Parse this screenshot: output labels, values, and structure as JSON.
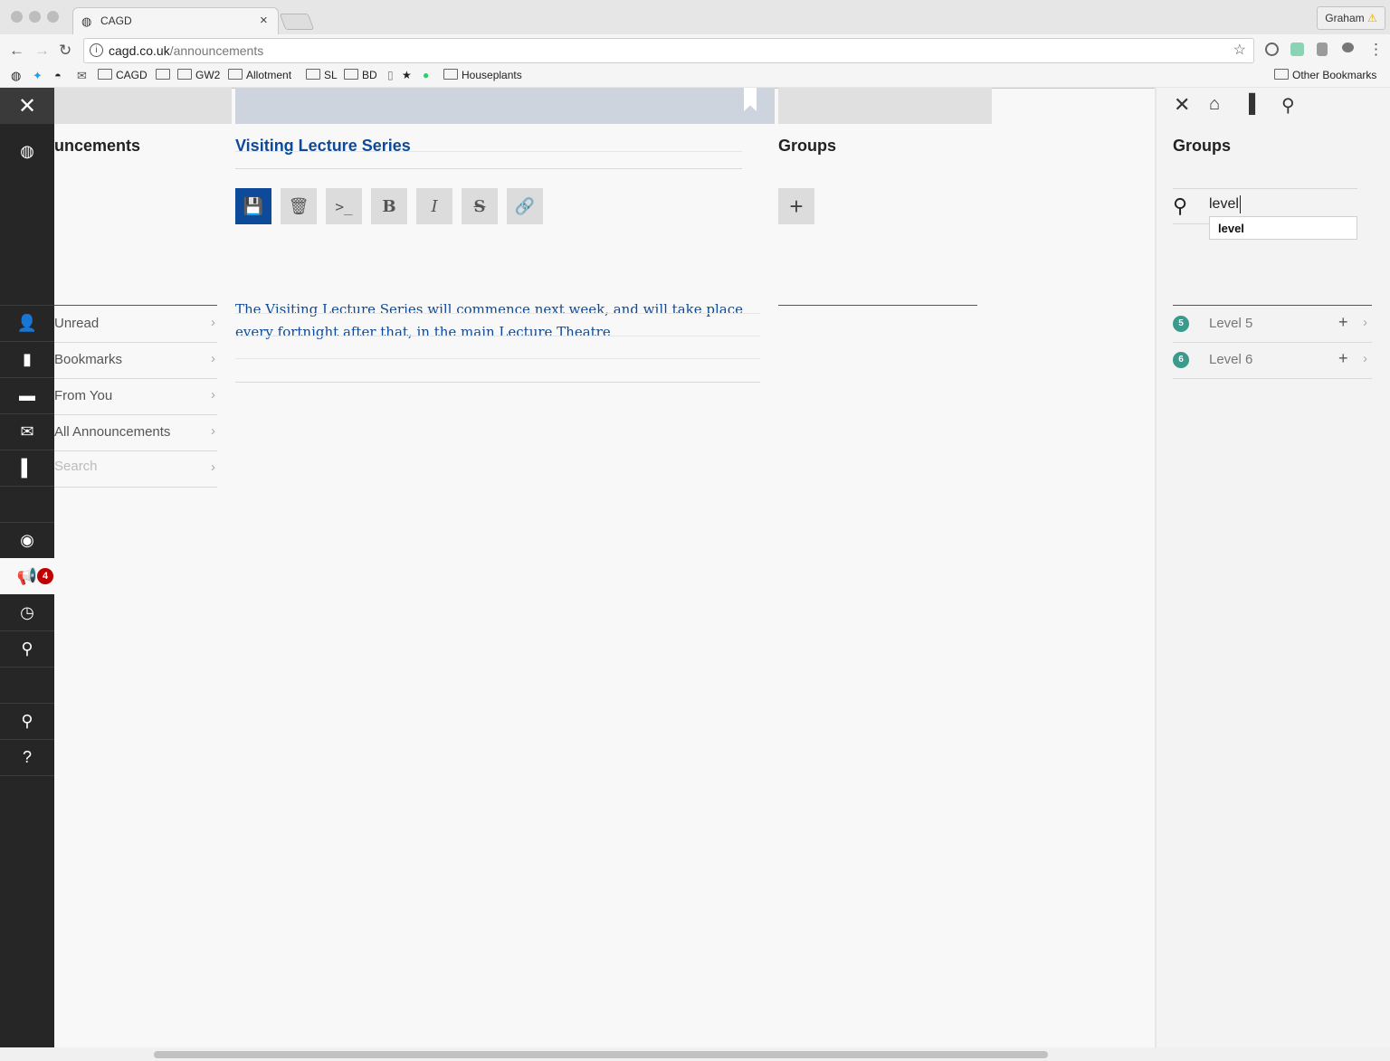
{
  "browser": {
    "tab_title": "CAGD",
    "url_host": "cagd.co.uk",
    "url_path": "/announcements",
    "profile_name": "Graham",
    "bookmarks": [
      "CAGD",
      "GW2",
      "Allotment",
      "SL",
      "BD",
      "★",
      "Houseplants"
    ],
    "other_bookmarks": "Other Bookmarks"
  },
  "rail": {
    "badge_count": "4",
    "icons": [
      "close-icon",
      "logo-icon",
      "user-icon",
      "bookmarks-icon",
      "folder-icon",
      "mail-icon",
      "bookmark-icon",
      "globe-icon",
      "megaphone-icon",
      "clock-icon",
      "pin-icon",
      "search-icon",
      "help-icon"
    ]
  },
  "left_column": {
    "header": "uncements",
    "menu": [
      "Unread",
      "Bookmarks",
      "From You",
      "All Announcements",
      "Search"
    ]
  },
  "editor": {
    "title": "Visiting Lecture Series",
    "body": "The Visiting Lecture Series will commence next week, and will take place every fortnight after that, in the main Lecture Theatre",
    "tools": [
      "save-icon",
      "trash-icon",
      "terminal-icon",
      "bold-icon",
      "italic-icon",
      "strike-icon",
      "link-icon"
    ]
  },
  "groups_column": {
    "header": "Groups"
  },
  "right_panel": {
    "header": "Groups",
    "search_value": "level",
    "suggestion": "level",
    "results": [
      {
        "num": "5",
        "name": "Level 5"
      },
      {
        "num": "6",
        "name": "Level 6"
      }
    ]
  },
  "colors": {
    "accent": "#0d4a99",
    "rail": "#262626",
    "badge": "#c00000",
    "group_dot": "#3a9a8c"
  }
}
